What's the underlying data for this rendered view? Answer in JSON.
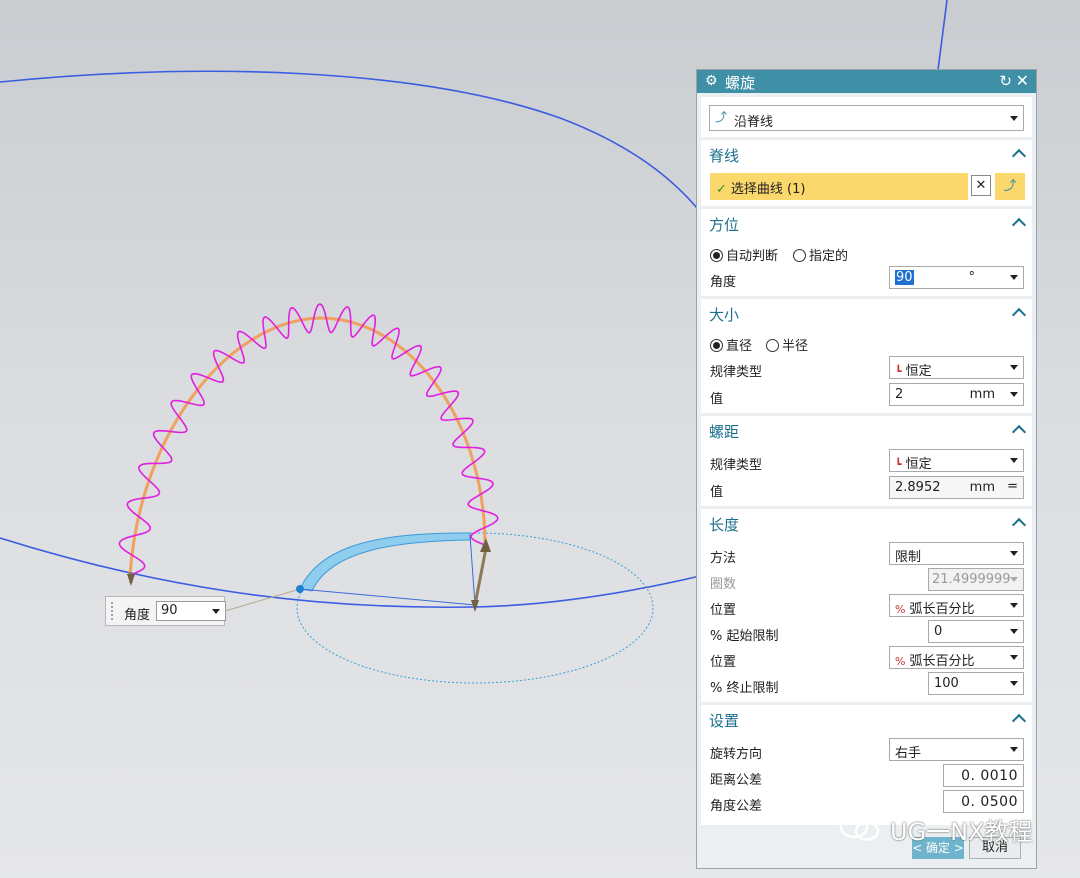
{
  "callout": {
    "label": "角度",
    "value": "90"
  },
  "dialog": {
    "title": "螺旋",
    "type_select": "沿脊线",
    "spine": {
      "header": "脊线",
      "select_curve": "选择曲线 (1)"
    },
    "orientation": {
      "header": "方位",
      "radio_auto": "自动判断",
      "radio_specified": "指定的",
      "angle_label": "角度",
      "angle_value": "90",
      "angle_unit": "°"
    },
    "size": {
      "header": "大小",
      "radio_diameter": "直径",
      "radio_radius": "半径",
      "law_label": "规律类型",
      "law_value": "恒定",
      "value_label": "值",
      "value": "2",
      "unit": "mm"
    },
    "pitch": {
      "header": "螺距",
      "law_label": "规律类型",
      "law_value": "恒定",
      "value_label": "值",
      "value": "2.8952",
      "unit": "mm",
      "eq": "="
    },
    "length": {
      "header": "长度",
      "method_label": "方法",
      "method_value": "限制",
      "turns_label": "圈数",
      "turns_value": "21.4999999",
      "position1_label": "位置",
      "position1_value": "弧长百分比",
      "start_label": "% 起始限制",
      "start_value": "0",
      "position2_label": "位置",
      "position2_value": "弧长百分比",
      "end_label": "% 终止限制",
      "end_value": "100"
    },
    "settings": {
      "header": "设置",
      "rotation_label": "旋转方向",
      "rotation_value": "右手",
      "dist_tol_label": "距离公差",
      "dist_tol_value": "0. 0010",
      "angle_tol_label": "角度公差",
      "angle_tol_value": "0. 0500"
    },
    "ok_label": "< 确定 >",
    "cancel_label": "取消"
  },
  "watermark": "UG一NX教程",
  "colors": {
    "title_bar": "#3f8fa6",
    "section_header": "#1d6f8e",
    "selection_highlight": "#fbd86b",
    "spine_curve": "#f0a060",
    "helix_curve": "#e020e0",
    "blue_curve": "#3b5de0"
  }
}
